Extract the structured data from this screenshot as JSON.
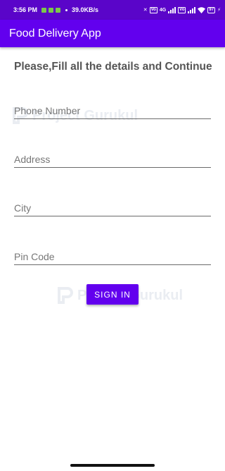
{
  "status_bar": {
    "time": "3:56 PM",
    "speed": "39.0KB/s",
    "vo_label": "Vo",
    "lte_label": "4G",
    "battery": "97"
  },
  "app_bar": {
    "title": "Food Delivery App"
  },
  "form": {
    "heading": "Please,Fill all the details and Continue",
    "phone_placeholder": "Phone Number",
    "address_placeholder": "Address",
    "city_placeholder": "City",
    "pincode_placeholder": "Pin Code",
    "signin_label": "SIGN IN"
  },
  "watermark": {
    "text": "Project Gurukul"
  },
  "colors": {
    "primary": "#6200ee",
    "status_bar": "#5a05c9"
  }
}
